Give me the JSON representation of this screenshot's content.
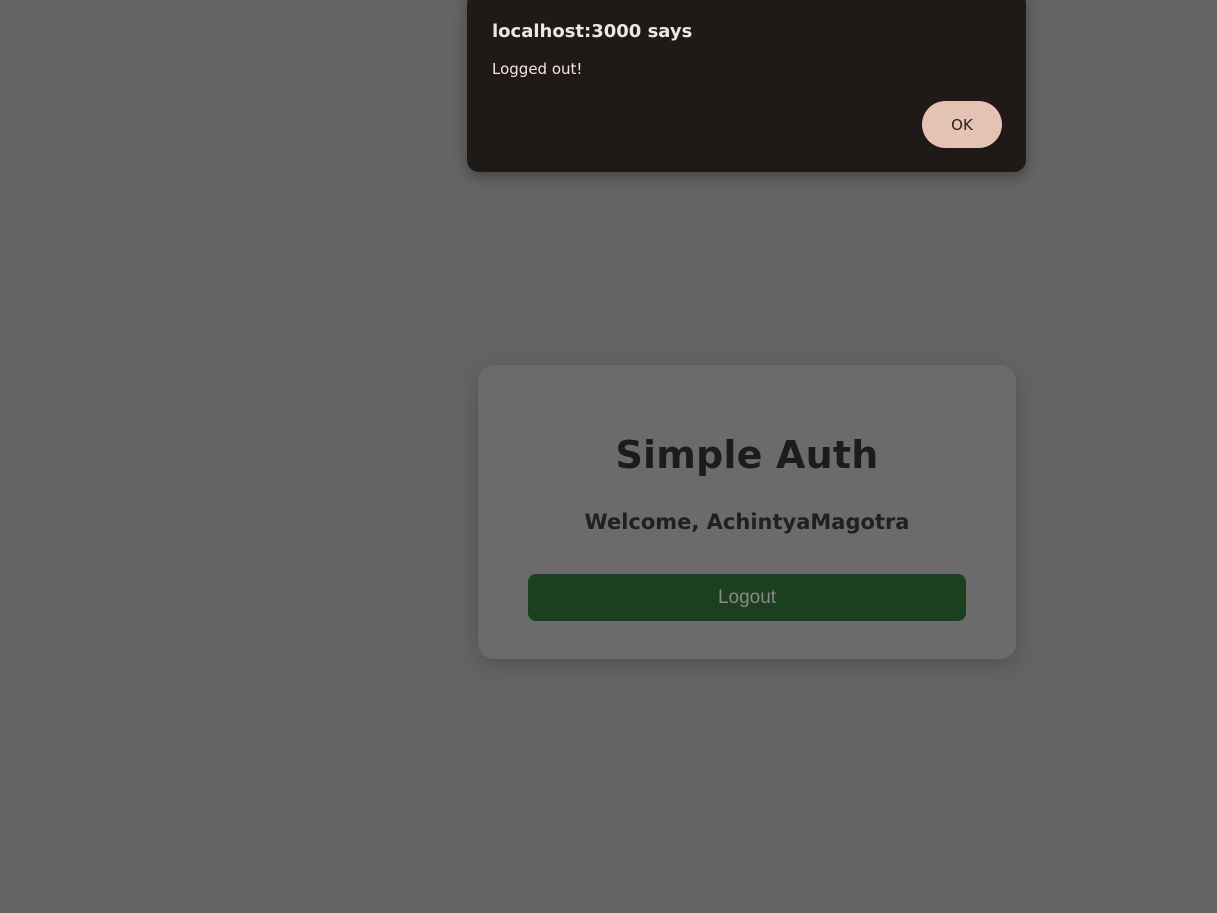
{
  "alert": {
    "title": "localhost:3000 says",
    "message": "Logged out!",
    "ok_label": "OK"
  },
  "auth_card": {
    "title": "Simple Auth",
    "welcome": "Welcome, AchintyaMagotra",
    "logout_label": "Logout"
  },
  "colors": {
    "page_background": "#636466",
    "card_background": "#6b6b6b",
    "logout_button": "#1c3f1f",
    "alert_background": "#1f1a18",
    "alert_ok_button": "#e5c3b4"
  }
}
